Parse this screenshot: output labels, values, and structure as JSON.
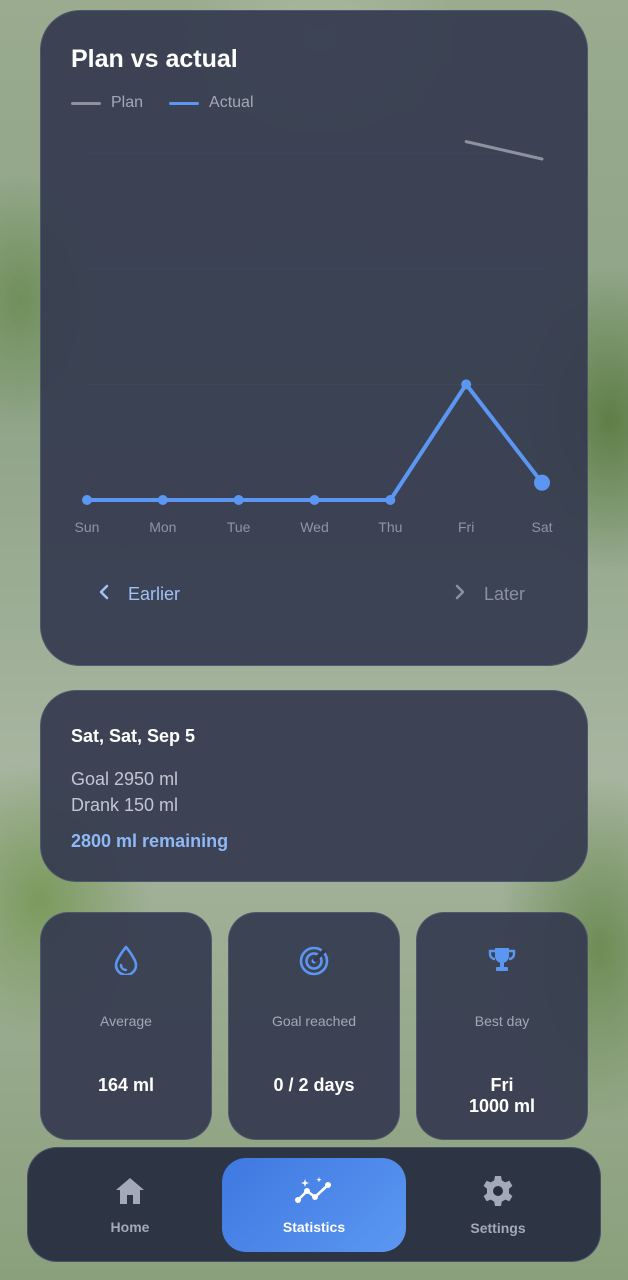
{
  "chart_card": {
    "title": "Plan vs actual",
    "legend": [
      {
        "label": "Plan",
        "color": "#8d929e"
      },
      {
        "label": "Actual",
        "color": "#5b97f2"
      }
    ],
    "earlier_label": "Earlier",
    "later_label": "Later"
  },
  "chart_data": {
    "type": "line",
    "title": "Plan vs actual",
    "categories": [
      "Sun",
      "Mon",
      "Tue",
      "Wed",
      "Thu",
      "Fri",
      "Sat"
    ],
    "series": [
      {
        "name": "Plan",
        "color": "#8d929e",
        "values": [
          null,
          null,
          null,
          null,
          null,
          3100,
          2950
        ]
      },
      {
        "name": "Actual",
        "color": "#5b97f2",
        "values": [
          0,
          0,
          0,
          0,
          0,
          1000,
          150
        ]
      }
    ],
    "ylim": [
      0,
      3500
    ],
    "gridlines": [
      1000,
      2000,
      3000
    ],
    "highlight_index": 6
  },
  "day_card": {
    "title": "Sat, Sat, Sep 5",
    "goal": "Goal  2950 ml",
    "drank": "Drank  150 ml",
    "remaining": "2800 ml remaining"
  },
  "stats": [
    {
      "icon": "water-drop-icon",
      "label": "Average",
      "value": "164 ml"
    },
    {
      "icon": "target-icon",
      "label": "Goal reached",
      "value": "0 / 2 days"
    },
    {
      "icon": "trophy-icon",
      "label": "Best day",
      "value": "Fri\n1000 ml"
    }
  ],
  "nav": [
    {
      "label": "Home",
      "icon": "home-icon",
      "active": false
    },
    {
      "label": "Statistics",
      "icon": "statistics-icon",
      "active": true
    },
    {
      "label": "Settings",
      "icon": "gear-icon",
      "active": false
    }
  ],
  "colors": {
    "accent": "#5b97f2",
    "card": "#343a4e"
  }
}
